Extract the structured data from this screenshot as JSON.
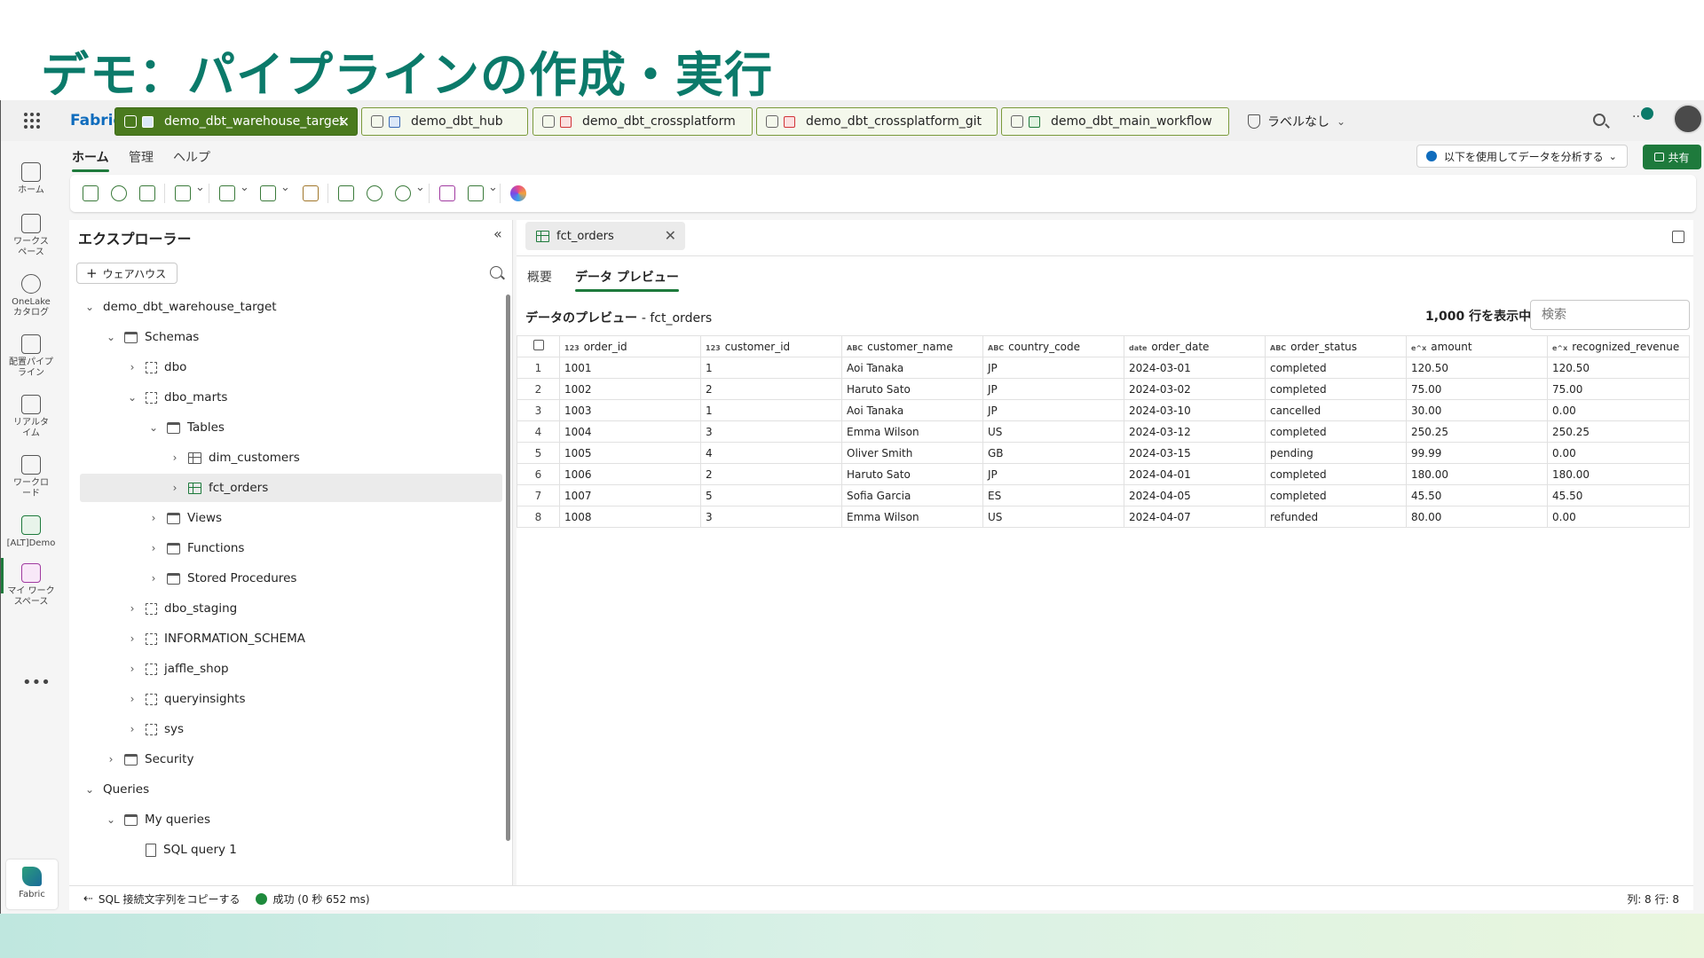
{
  "slide_title": "デモ：パイプラインの作成・実行",
  "topbar": {
    "brand": "Fabric",
    "tabs": [
      {
        "label": "demo_dbt_warehouse_target",
        "active": true
      },
      {
        "label": "demo_dbt_hub",
        "active": false
      },
      {
        "label": "demo_dbt_crossplatform",
        "active": false
      },
      {
        "label": "demo_dbt_crossplatform_git",
        "active": false
      },
      {
        "label": "demo_dbt_main_workflow",
        "active": false
      }
    ],
    "sensitivity_label": "ラベルなし"
  },
  "rail": {
    "items": [
      {
        "label": "ホーム",
        "icon": "home-icon"
      },
      {
        "label": "ワークスペース",
        "icon": "workspaces-icon"
      },
      {
        "label": "OneLake カタログ",
        "icon": "onelake-icon"
      },
      {
        "label": "配置パイプライン",
        "icon": "deployment-pipeline-icon"
      },
      {
        "label": "リアルタイム",
        "icon": "realtime-icon"
      },
      {
        "label": "ワークロード",
        "icon": "workload-icon"
      },
      {
        "label": "[ALT]Demo",
        "icon": "warehouse-icon"
      },
      {
        "label": "マイ ワークスペース",
        "icon": "my-workspace-icon"
      }
    ],
    "more": "•••",
    "fabric_label": "Fabric"
  },
  "ribbon": {
    "tabs": [
      "ホーム",
      "管理",
      "ヘルプ"
    ],
    "analyze_button": "以下を使用してデータを分析する",
    "share_button": "共有"
  },
  "explorer": {
    "title": "エクスプローラー",
    "add_warehouse": "ウェアハウス",
    "tree": [
      {
        "label": "demo_dbt_warehouse_target",
        "level": 0,
        "expanded": true,
        "icon": "warehouse"
      },
      {
        "label": "Schemas",
        "level": 1,
        "expanded": true,
        "icon": "folder"
      },
      {
        "label": "dbo",
        "level": 2,
        "expanded": false,
        "icon": "schema"
      },
      {
        "label": "dbo_marts",
        "level": 2,
        "expanded": true,
        "icon": "schema"
      },
      {
        "label": "Tables",
        "level": 3,
        "expanded": true,
        "icon": "folder"
      },
      {
        "label": "dim_customers",
        "level": 4,
        "expanded": false,
        "icon": "table"
      },
      {
        "label": "fct_orders",
        "level": 4,
        "expanded": false,
        "icon": "table",
        "selected": true
      },
      {
        "label": "Views",
        "level": 3,
        "expanded": false,
        "icon": "folder"
      },
      {
        "label": "Functions",
        "level": 3,
        "expanded": false,
        "icon": "folder"
      },
      {
        "label": "Stored Procedures",
        "level": 3,
        "expanded": false,
        "icon": "folder"
      },
      {
        "label": "dbo_staging",
        "level": 2,
        "expanded": false,
        "icon": "schema"
      },
      {
        "label": "INFORMATION_SCHEMA",
        "level": 2,
        "expanded": false,
        "icon": "schema"
      },
      {
        "label": "jaffle_shop",
        "level": 2,
        "expanded": false,
        "icon": "schema"
      },
      {
        "label": "queryinsights",
        "level": 2,
        "expanded": false,
        "icon": "schema"
      },
      {
        "label": "sys",
        "level": 2,
        "expanded": false,
        "icon": "schema"
      },
      {
        "label": "Security",
        "level": 1,
        "expanded": false,
        "icon": "folder"
      },
      {
        "label": "Queries",
        "level": 0,
        "expanded": true,
        "icon": "none"
      },
      {
        "label": "My queries",
        "level": 1,
        "expanded": true,
        "icon": "folder"
      },
      {
        "label": "SQL query 1",
        "level": 2,
        "expanded": null,
        "icon": "query"
      }
    ]
  },
  "content": {
    "doc_tab": "fct_orders",
    "sub_tabs": [
      "概要",
      "データ プレビュー"
    ],
    "preview_title": "データのプレビュー",
    "preview_table": "- fct_orders",
    "row_count": "1,000 行を表示中",
    "search_placeholder": "検索",
    "columns": [
      {
        "type": "123",
        "name": "order_id"
      },
      {
        "type": "123",
        "name": "customer_id"
      },
      {
        "type": "ABC",
        "name": "customer_name"
      },
      {
        "type": "ABC",
        "name": "country_code"
      },
      {
        "type": "date",
        "name": "order_date"
      },
      {
        "type": "ABC",
        "name": "order_status"
      },
      {
        "type": "e^x",
        "name": "amount"
      },
      {
        "type": "e^x",
        "name": "recognized_revenue"
      }
    ],
    "rows": [
      [
        "1",
        "1001",
        "1",
        "Aoi Tanaka",
        "JP",
        "2024-03-01",
        "completed",
        "120.50",
        "120.50"
      ],
      [
        "2",
        "1002",
        "2",
        "Haruto Sato",
        "JP",
        "2024-03-02",
        "completed",
        "75.00",
        "75.00"
      ],
      [
        "3",
        "1003",
        "1",
        "Aoi Tanaka",
        "JP",
        "2024-03-10",
        "cancelled",
        "30.00",
        "0.00"
      ],
      [
        "4",
        "1004",
        "3",
        "Emma Wilson",
        "US",
        "2024-03-12",
        "completed",
        "250.25",
        "250.25"
      ],
      [
        "5",
        "1005",
        "4",
        "Oliver Smith",
        "GB",
        "2024-03-15",
        "pending",
        "99.99",
        "0.00"
      ],
      [
        "6",
        "1006",
        "2",
        "Haruto Sato",
        "JP",
        "2024-04-01",
        "completed",
        "180.00",
        "180.00"
      ],
      [
        "7",
        "1007",
        "5",
        "Sofia Garcia",
        "ES",
        "2024-04-05",
        "completed",
        "45.50",
        "45.50"
      ],
      [
        "8",
        "1008",
        "3",
        "Emma Wilson",
        "US",
        "2024-04-07",
        "refunded",
        "80.00",
        "0.00"
      ]
    ]
  },
  "statusbar": {
    "copy_sql": "SQL 接続文字列をコピーする",
    "status": "成功 (0 秒 652 ms)",
    "position": "列: 8 行: 8"
  }
}
